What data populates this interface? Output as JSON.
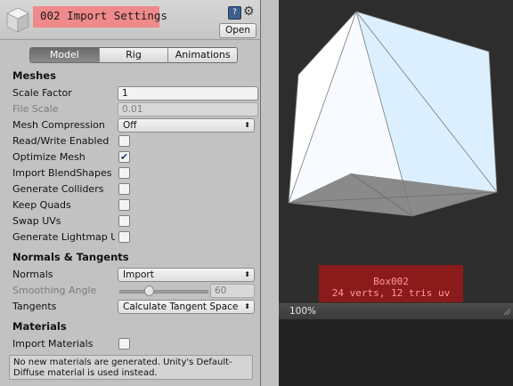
{
  "header": {
    "title": "002 Import Settings",
    "open_label": "Open",
    "help_glyph": "?",
    "gear_glyph": "⚙"
  },
  "tabs": [
    {
      "label": "Model",
      "active": true
    },
    {
      "label": "Rig",
      "active": false
    },
    {
      "label": "Animations",
      "active": false
    }
  ],
  "meshes": {
    "heading": "Meshes",
    "scale_factor_label": "Scale Factor",
    "scale_factor_value": "1",
    "file_scale_label": "File Scale",
    "file_scale_value": "0.01",
    "mesh_compression_label": "Mesh Compression",
    "mesh_compression_value": "Off",
    "read_write_label": "Read/Write Enabled",
    "read_write_checked": false,
    "optimize_mesh_label": "Optimize Mesh",
    "optimize_mesh_checked": true,
    "import_blendshapes_label": "Import BlendShapes",
    "import_blendshapes_checked": false,
    "generate_colliders_label": "Generate Colliders",
    "generate_colliders_checked": false,
    "keep_quads_label": "Keep Quads",
    "keep_quads_checked": false,
    "swap_uvs_label": "Swap UVs",
    "swap_uvs_checked": false,
    "generate_lightmap_label": "Generate Lightmap UVs",
    "generate_lightmap_checked": false
  },
  "normals_tangents": {
    "heading": "Normals & Tangents",
    "normals_label": "Normals",
    "normals_value": "Import",
    "smoothing_angle_label": "Smoothing Angle",
    "smoothing_angle_value": "60",
    "tangents_label": "Tangents",
    "tangents_value": "Calculate Tangent Space"
  },
  "materials": {
    "heading": "Materials",
    "import_materials_label": "Import Materials",
    "import_materials_checked": false,
    "help_text": "No new materials are generated. Unity's Default-Diffuse material is used instead."
  },
  "preview": {
    "mesh_name": "Box002",
    "mesh_stats": "24 verts, 12 tris   uv",
    "zoom": "100%"
  },
  "colors": {
    "title_highlight": "#f08a8a",
    "info_box_bg": "#8b1a1a",
    "info_box_text": "#ff9b9b",
    "preview_bg": "#2d2d2d",
    "panel_bg": "#c2c2c2"
  },
  "checkmark_glyph": "✔",
  "dropdown_arrow_glyph": "⬍"
}
